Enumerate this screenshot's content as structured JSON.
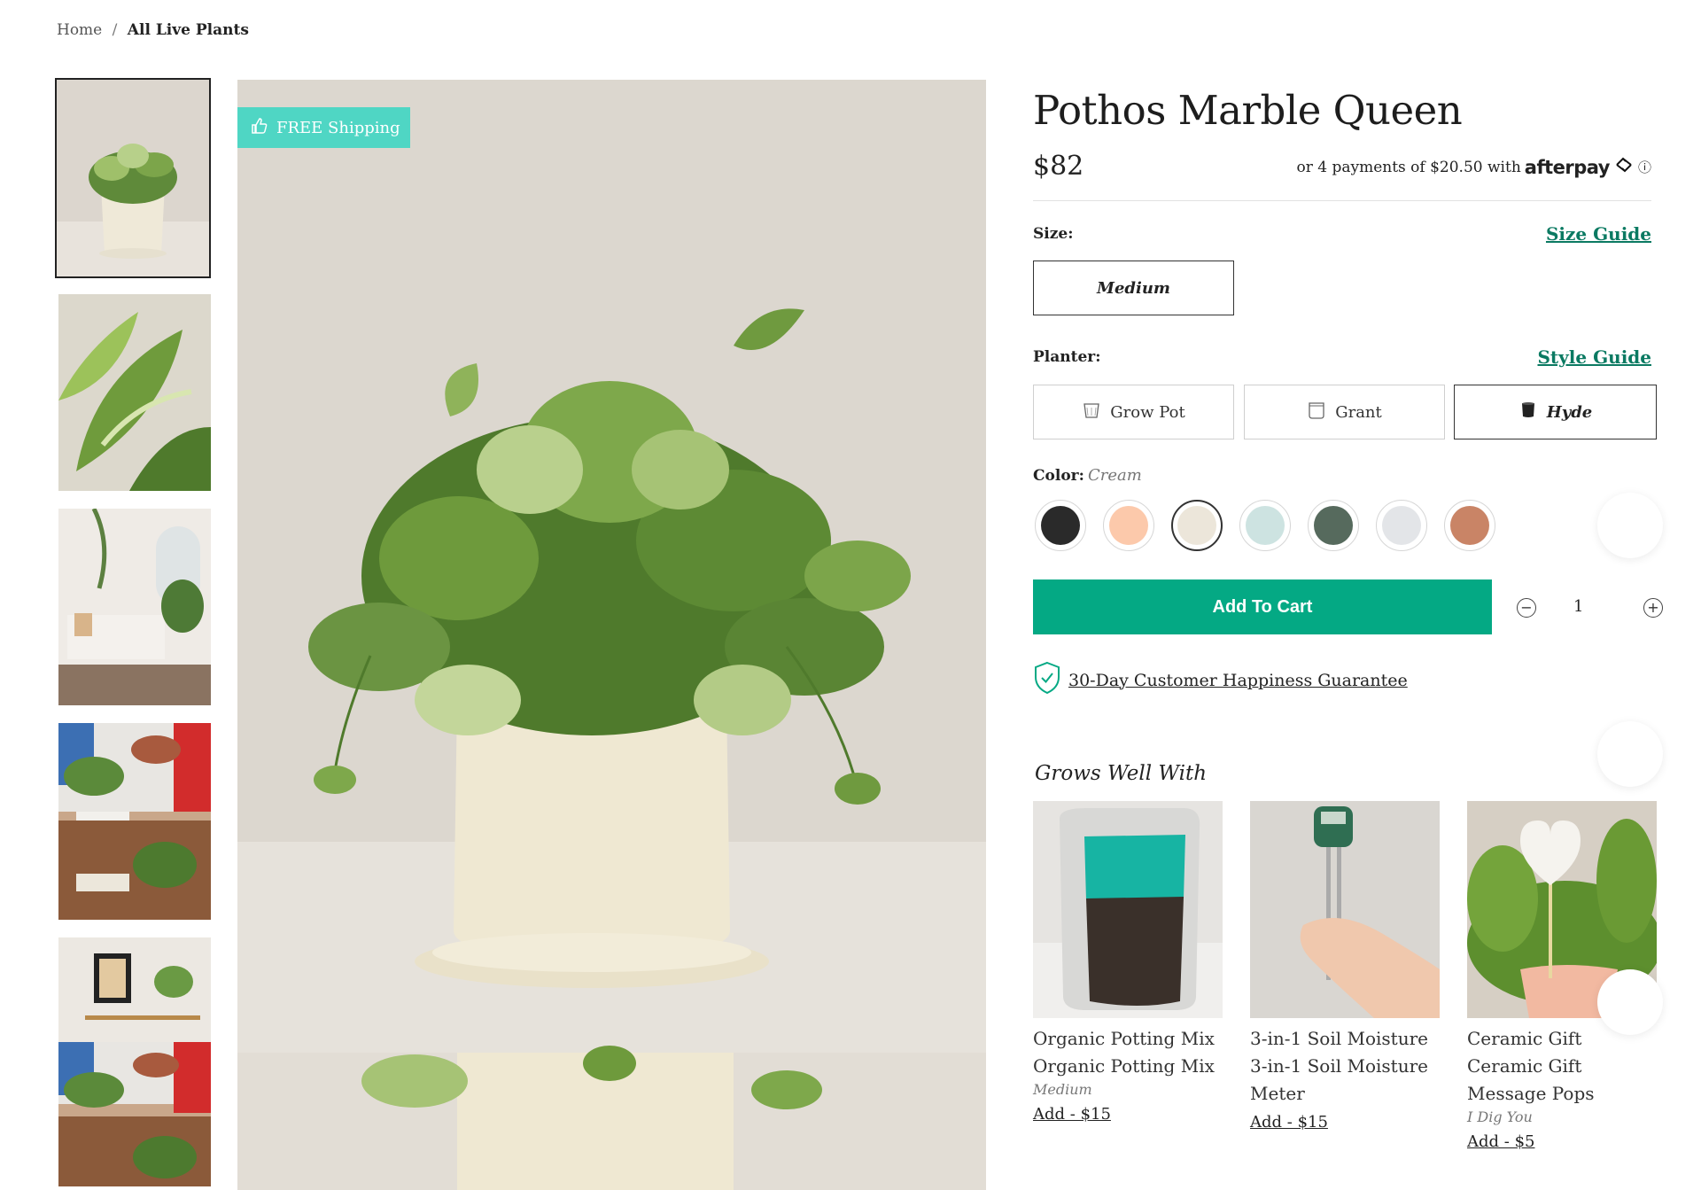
{
  "breadcrumb": {
    "home": "Home",
    "separator": "/",
    "current": "All Live Plants"
  },
  "badge": {
    "label": "FREE Shipping"
  },
  "product": {
    "title": "Pothos Marble Queen",
    "price": "$82",
    "afterpay_text": "or 4 payments of $20.50 with",
    "afterpay_brand": "afterpay",
    "afterpay_info": "ⓘ"
  },
  "size": {
    "label": "Size:",
    "guide": "Size Guide",
    "options": [
      "Medium"
    ],
    "selected": "Medium"
  },
  "planter": {
    "label": "Planter:",
    "guide": "Style Guide",
    "options": [
      "Grow Pot",
      "Grant",
      "Hyde"
    ],
    "selected": "Hyde"
  },
  "color": {
    "label": "Color:",
    "value": "Cream",
    "swatches": [
      "#2a2a2a",
      "#fcc9ab",
      "#ece6da",
      "#cde3e1",
      "#566a5d",
      "#e3e5e8",
      "#c98466"
    ],
    "selected_index": 2
  },
  "cart": {
    "button": "Add To Cart",
    "minus": "−",
    "plus": "+",
    "quantity": "1"
  },
  "guarantee": {
    "text": "30-Day Customer Happiness Guarantee"
  },
  "grows_well_with": {
    "title": "Grows Well With",
    "products": [
      {
        "name": "Organic Potting Mix",
        "name2": "Organic Potting Mix",
        "variant": "Medium",
        "add": "Add - $15"
      },
      {
        "name": "3-in-1 Soil Moisture",
        "name2": "3-in-1 Soil Moisture Meter",
        "variant": "",
        "add": "Add - $15"
      },
      {
        "name": "Ceramic Gift",
        "name2": "Ceramic Gift Message Pops",
        "variant": "I Dig You",
        "add": "Add - $5"
      }
    ]
  },
  "colors": {
    "accent": "#04a984",
    "badge": "#4fd6c4",
    "link": "#0b7a62"
  },
  "icons": [
    "thumbs-up-icon",
    "grow-pot-icon",
    "grant-icon",
    "hyde-icon",
    "shield-check-icon",
    "minus-icon",
    "plus-icon",
    "info-icon"
  ]
}
